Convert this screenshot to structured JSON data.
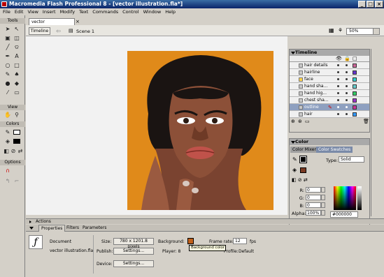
{
  "window": {
    "title": "Macromedia Flash Professional 8 - [vector illustration.fla*]"
  },
  "menu": [
    "File",
    "Edit",
    "View",
    "Insert",
    "Modify",
    "Text",
    "Commands",
    "Control",
    "Window",
    "Help"
  ],
  "tools": {
    "header": "Tools",
    "view_label": "View",
    "colors_label": "Colors",
    "options_label": "Options"
  },
  "document": {
    "tab": "vector illustration.fla*",
    "timeline_button": "Timeline",
    "scene": "Scene 1",
    "zoom": "50%"
  },
  "timeline": {
    "title": "Timeline",
    "layers": [
      {
        "name": "hair details",
        "color": "#cc6699"
      },
      {
        "name": "hairline",
        "color": "#6633cc"
      },
      {
        "name": "face",
        "color": "#33cccc"
      },
      {
        "name": "hand sha...",
        "color": "#66cccc"
      },
      {
        "name": "hand hig...",
        "color": "#33cc66"
      },
      {
        "name": "chest sha...",
        "color": "#9933cc"
      },
      {
        "name": "outline",
        "color": "#cc3399"
      },
      {
        "name": "hair",
        "color": "#3399ff"
      }
    ]
  },
  "color": {
    "title": "Color",
    "tabs": [
      "Color Mixer",
      "Color Swatches"
    ],
    "type_label": "Type:",
    "type_value": "Solid",
    "r_label": "R:",
    "r": "0",
    "g_label": "G:",
    "g": "0",
    "b_label": "B:",
    "b": "0",
    "alpha_label": "Alpha:",
    "alpha": "100%",
    "hex": "#000000"
  },
  "actions": {
    "label": "Actions"
  },
  "properties": {
    "tabs": [
      "Properties",
      "Filters",
      "Parameters"
    ],
    "doc_label": "Document",
    "file_name": "vector illustration.fla",
    "size_label": "Size:",
    "size_value": "780 x 1201.8 pixels",
    "background_label": "Background:",
    "background_color": "#c0601a",
    "frame_rate_label": "Frame rate:",
    "frame_rate": "12",
    "fps": "fps",
    "publish_label": "Publish:",
    "settings_label": "Settings...",
    "player_label": "Player: 8",
    "profile_label": "Profile:",
    "profile_value": "Default",
    "device_label": "Device:",
    "device_settings": "Settings...",
    "tooltip": "Background color"
  }
}
